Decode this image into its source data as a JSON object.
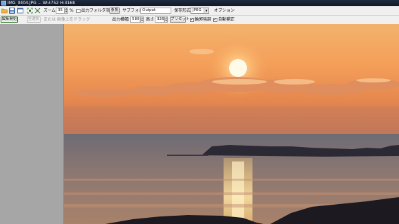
{
  "titlebar": {
    "title": "IMG_0404.JPG ...  W:4752 H:3168"
  },
  "toolbar1": {
    "icons": [
      "folder-open-icon",
      "save-icon",
      "window-icon",
      "fit-icon",
      "rotate-icon",
      "settings-icon"
    ],
    "zoom_label": "ズーム",
    "zoom_value": "35",
    "zoom_unit": "%",
    "output_folder_label": "出力フォルダ指定",
    "browse_label": "参照",
    "subfolder_label": "サブフォルダ",
    "subfolder_value": "Output",
    "save_format_label": "保存形式",
    "save_format_value": "JPEG",
    "options_label": "オプション"
  },
  "toolbar2": {
    "start_edit_label": "編集開始",
    "full_select_label": "全選択",
    "hint_text": "または 画像上をドラッグ",
    "output_label": "出力",
    "width_label": "横幅",
    "width_value": "580",
    "height_label": "高さ",
    "height_value": "326",
    "preset_label": "プリセット",
    "sharpen_label": "輪郭強調",
    "auto_correct_label": "自動補正"
  },
  "colors": {
    "titlebar": "#16213a",
    "left_panel": "#a6a6a6",
    "toolbar": "#f0f0f0",
    "start_button_border": "#3c7a3c"
  }
}
